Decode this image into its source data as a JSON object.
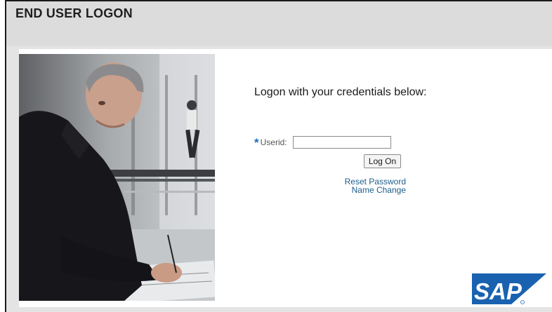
{
  "header": {
    "title": "END USER LOGON"
  },
  "login": {
    "prompt": "Logon with your credentials below:",
    "userid_label": "Userid:",
    "userid_required_mark": "*",
    "userid_value": "",
    "logon_button": "Log On",
    "links": [
      "Reset Password",
      "Name Change"
    ]
  },
  "logo": {
    "text": "SAP"
  },
  "colors": {
    "accent": "#1d6fb8",
    "link": "#1c5d8a",
    "header_bg": "#dcdcdc",
    "frame_bg": "#e4e4e4",
    "sap_blue": "#1a62b0"
  }
}
